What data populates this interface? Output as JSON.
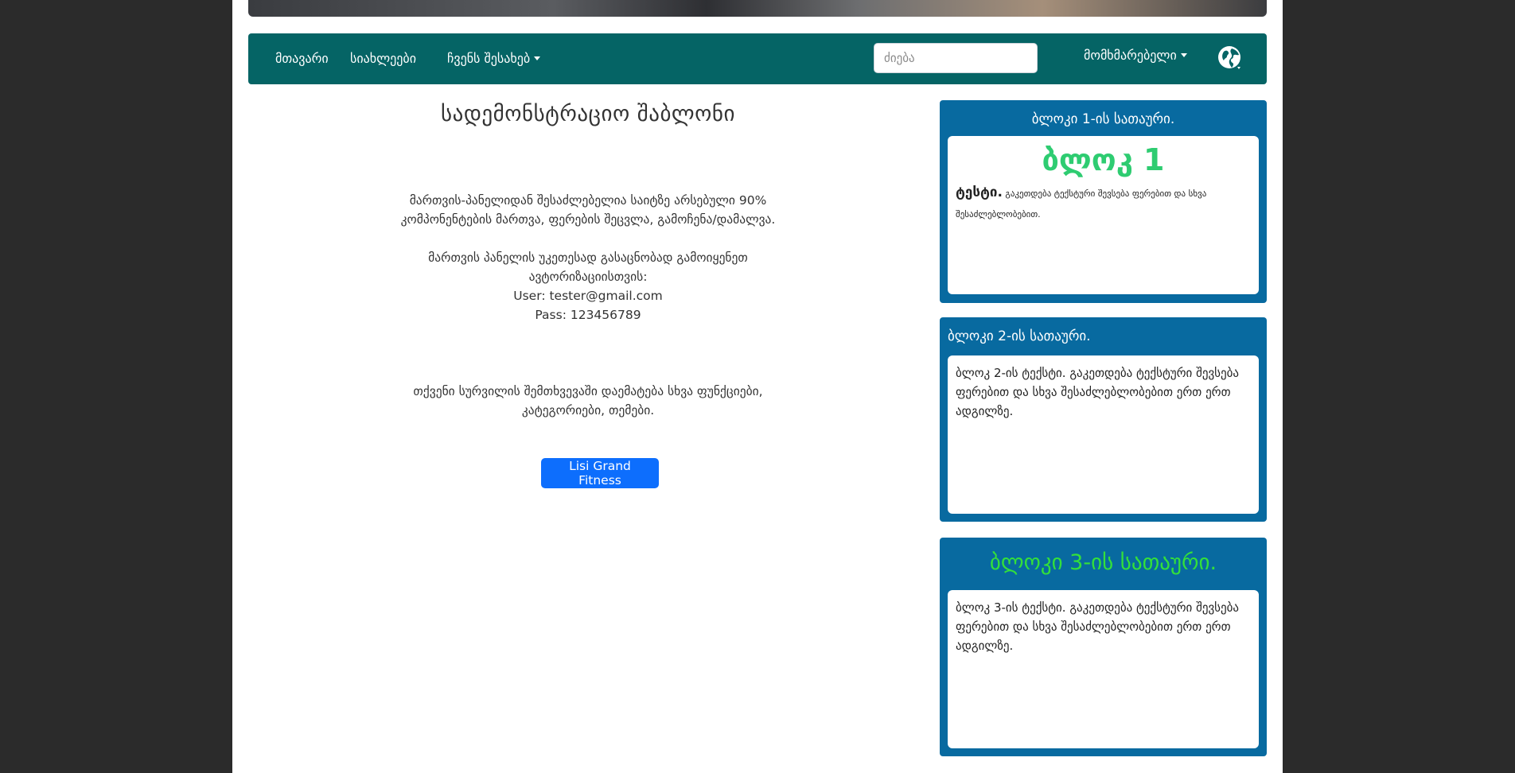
{
  "nav": {
    "home": "მთავარი",
    "news": "სიახლეები",
    "about": "ჩვენს შესახებ",
    "search_placeholder": "ძიება",
    "user": "მომხმარებელი"
  },
  "main": {
    "title": "სადემონსტრაციო შაბლონი",
    "p1": "მართვის-პანელიდან შესაძლებელია საიტზე არსებული 90% კომპონენტების მართვა, ფერების შეცვლა, გამოჩენა/დამალვა.",
    "p2_line1": "მართვის პანელის უკეთესად გასაცნობად გამოიყენეთ ავტორიზაციისთვის:",
    "p2_user": "User: tester@gmail.com",
    "p2_pass": "Pass: 123456789",
    "p3": "თქვენი სურვილის შემთხვევაში დაემატება სხვა ფუნქციები, კატეგორიები, თემები.",
    "button": "Lisi Grand Fitness"
  },
  "blocks": [
    {
      "heading": "ბლოკი 1-ის სათაური.",
      "big": "ბლოკ 1",
      "bold": "ტესტი.",
      "text": " გაკეთდება ტექსტური შევსება ფერებით და სხვა შესაძლებლობებით."
    },
    {
      "heading": "ბლოკი 2-ის სათაური.",
      "text": "ბლოკ 2-ის ტექსტი. გაკეთდება ტექსტური შევსება ფერებით და სხვა შესაძლებლობებით ერთ ერთ ადგილზე."
    },
    {
      "heading": "ბლოკი 3-ის სათაური.",
      "text": "ბლოკ 3-ის ტექსტი. გაკეთდება ტექსტური შევსება ფერებით და სხვა შესაძლებლობებით ერთ ერთ ადგილზე."
    }
  ],
  "colors": {
    "navbar": "#056465",
    "block": "#086aa0",
    "button": "#0d6efd",
    "accent_green": "#2ecc71"
  }
}
